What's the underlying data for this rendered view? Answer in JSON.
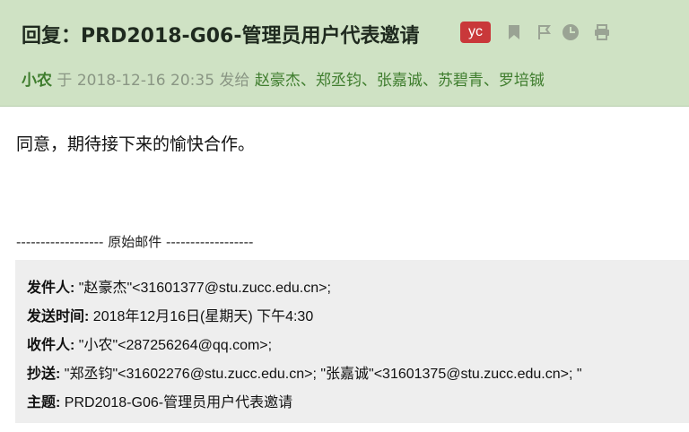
{
  "email": {
    "subject": "回复：PRD2018-G06-管理员用户代表邀请",
    "tag": "yc",
    "sender": "小农",
    "at_word": "于",
    "datetime": "2018-12-16 20:35",
    "sent_to_word": "发给",
    "recipients": "赵豪杰、郑丞钧、张嘉诚、苏碧青、罗培铖",
    "body": "同意，期待接下来的愉快合作。"
  },
  "original": {
    "divider": "------------------ 原始邮件 ------------------",
    "from_label": "发件人:",
    "from_value": "\"赵豪杰\"<31601377@stu.zucc.edu.cn>;",
    "time_label": "发送时间:",
    "time_value": "2018年12月16日(星期天) 下午4:30",
    "to_label": "收件人:",
    "to_value": "\"小农\"<287256264@qq.com>;",
    "cc_label": "抄送:",
    "cc_value": "\"郑丞钧\"<31602276@stu.zucc.edu.cn>; \"张嘉诚\"<31601375@stu.zucc.edu.cn>; \"",
    "subject_label": "主题:",
    "subject_value": "PRD2018-G06-管理员用户代表邀请"
  },
  "icons": [
    "bookmark-icon",
    "flag-icon",
    "clock-icon",
    "print-icon"
  ],
  "colors": {
    "header_bg": "#cfe2c4",
    "tag_bg": "#c9383a",
    "sender": "#3f7d2e",
    "quote_bg": "#eeeeee"
  }
}
